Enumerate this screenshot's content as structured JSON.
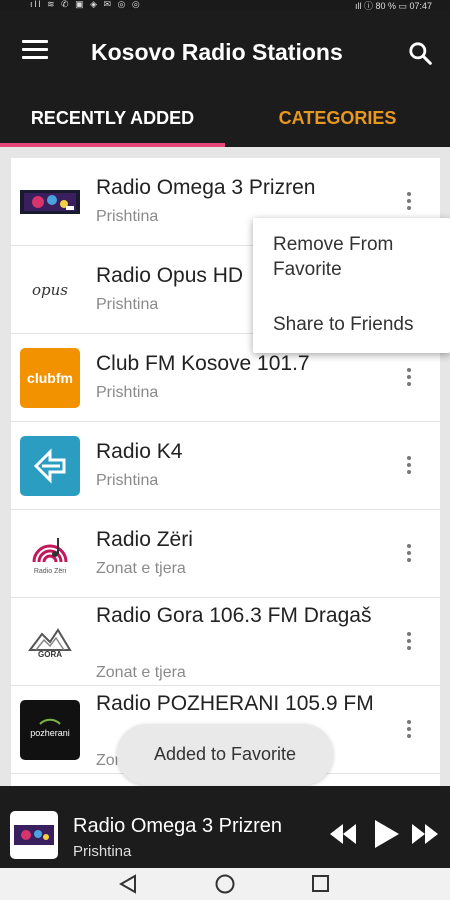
{
  "status_bar": {
    "left": "ıll ≋ ✆ ▣ ◈ ✉ ◎ ◎",
    "right": "ıll ⓘ 80 % ▭ 07:47"
  },
  "app_bar": {
    "title": "Kosovo Radio Stations"
  },
  "tabs": [
    {
      "label": "RECENTLY ADDED",
      "active": true
    },
    {
      "label": "CATEGORIES",
      "active": false
    }
  ],
  "stations": [
    {
      "name": "Radio Omega 3 Prizren",
      "location": "Prishtina",
      "logo": "omega-logo"
    },
    {
      "name": "Radio Opus HD",
      "location": "Prishtina",
      "logo": "opus-logo",
      "logo_text": "opus"
    },
    {
      "name": "Club FM Kosove 101.7",
      "location": "Prishtina",
      "logo": "clubfm-logo",
      "logo_text": "clubfm"
    },
    {
      "name": "Radio K4",
      "location": "Prishtina",
      "logo": "k4-logo"
    },
    {
      "name": "Radio Zëri",
      "location": "Zonat e tjera",
      "logo": "zeri-logo",
      "logo_text": "Radio Zëri"
    },
    {
      "name": "Radio Gora 106.3 FM Dragaš",
      "location": "Zonat e tjera",
      "logo": "gora-logo",
      "logo_text": "GORA"
    },
    {
      "name": "Radio POZHERANI 105.9 FM",
      "location": "Zonat e tjera",
      "logo": "pozherani-logo",
      "logo_text": "pozherani"
    }
  ],
  "popup_menu": {
    "items": [
      "Remove From Favorite",
      "Share to Friends"
    ]
  },
  "toast": {
    "message": "Added to Favorite"
  },
  "player": {
    "title": "Radio Omega 3 Prizren",
    "subtitle": "Prishtina",
    "controls": [
      "rewind-icon",
      "play-icon",
      "fast-forward-icon"
    ]
  },
  "nav_bar": {
    "buttons": [
      "back-icon",
      "home-icon",
      "recents-icon"
    ]
  },
  "colors": {
    "app_bar": "#1c1c1c",
    "tab_active_text": "#ffffff",
    "tab_inactive_text": "#e8971f",
    "tab_indicator": "#e8467a",
    "clubfm_orange": "#f39200",
    "k4_teal": "#2a9dc0"
  }
}
